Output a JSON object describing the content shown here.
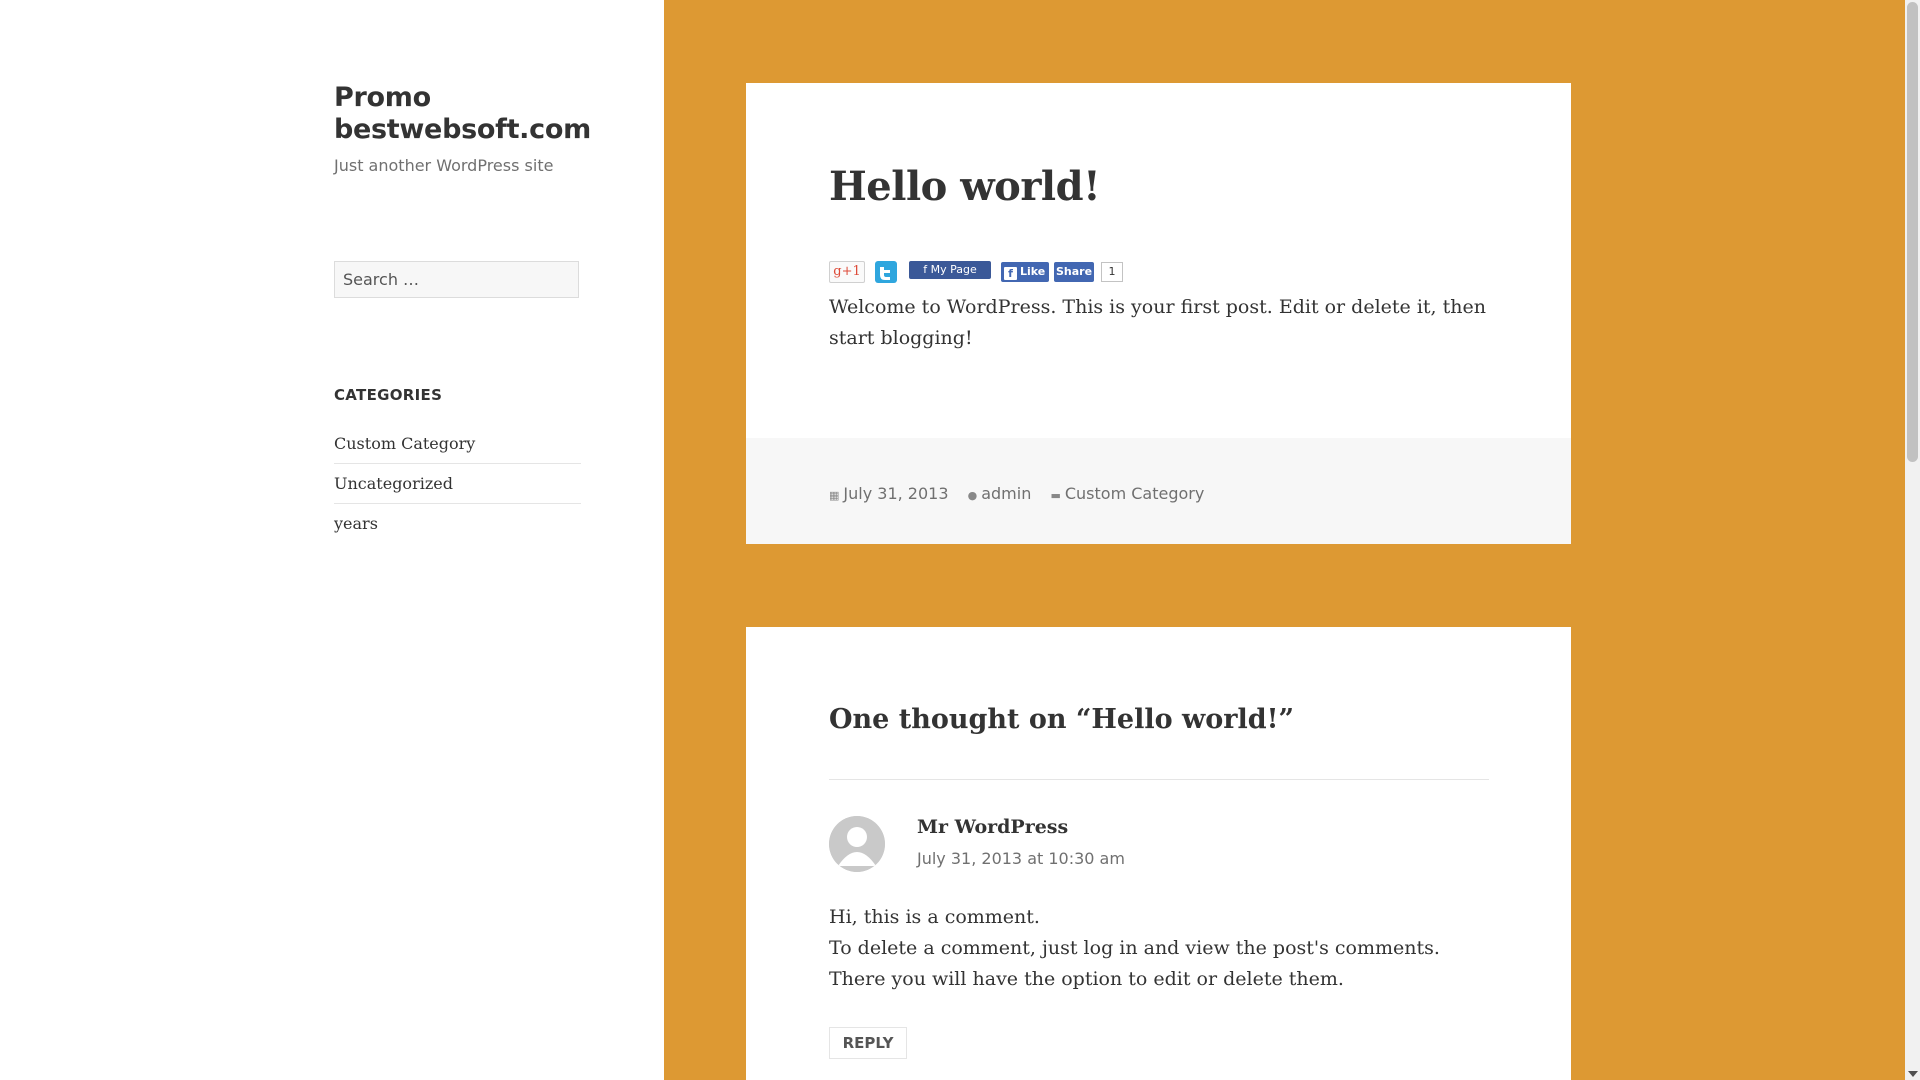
{
  "site": {
    "title": "Promo bestwebsoft.com",
    "description": "Just another WordPress site"
  },
  "search": {
    "placeholder": "Search …"
  },
  "categories": {
    "heading": "CATEGORIES",
    "items": [
      "Custom Category",
      "Uncategorized",
      "years"
    ]
  },
  "post": {
    "title": "Hello world!",
    "share": {
      "gplus_label": "g+1",
      "mypage_label": "f  My Page",
      "like_label": "Like",
      "share_label": "Share",
      "count": "1"
    },
    "body": "Welcome to WordPress. This is your first post. Edit or delete it, then start blogging!",
    "meta": {
      "date": "July 31, 2013",
      "author": "admin",
      "category": "Custom Category"
    }
  },
  "comments": {
    "title": "One thought on “Hello world!”",
    "items": [
      {
        "author": "Mr WordPress",
        "date": "July 31, 2013 at 10:30 am",
        "line1": "Hi, this is a comment.",
        "line2": "To delete a comment, just log in and view the post's comments. There you will have the option to edit or delete them.",
        "reply_label": "REPLY"
      }
    ]
  },
  "colors": {
    "background": "#dd9933",
    "sidebar": "#ffffff",
    "card": "#ffffff",
    "footer": "#f7f7f7",
    "facebook": "#4267b2",
    "twitter": "#2fa6de"
  }
}
